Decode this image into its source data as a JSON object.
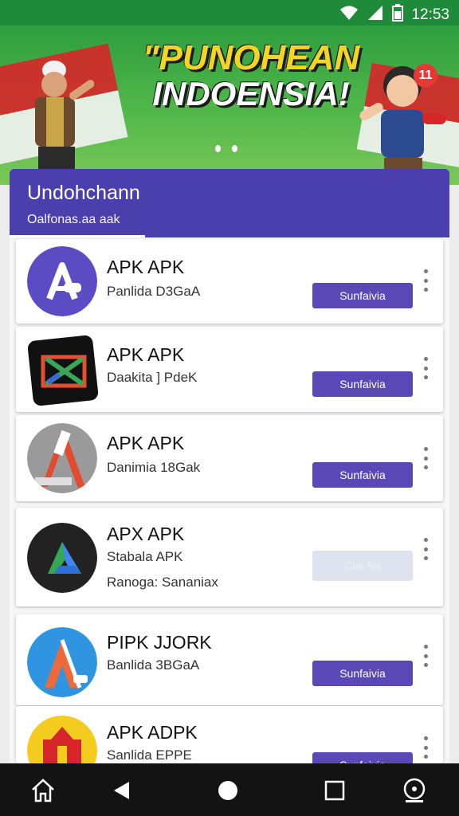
{
  "status_bar": {
    "time": "12:53"
  },
  "banner": {
    "headline_line1": "\"PUNOHEAN",
    "headline_line2": "INDOENSIA!",
    "notification_count": "11"
  },
  "panel": {
    "title": "Undohchann",
    "subtitle": "Oalfonas.aa aak"
  },
  "apps": [
    {
      "title": "APK APK",
      "subtitle": "Panlida D3GaA",
      "button": "Sunfaivia",
      "enabled": true
    },
    {
      "title": "APK APK",
      "subtitle": "Daakita ] PdeK",
      "button": "Sunfaivia",
      "enabled": true
    },
    {
      "title": "APK APK",
      "subtitle": "Danimia 18Gak",
      "button": "Sunfaivia",
      "enabled": true
    },
    {
      "title": "APX APK",
      "subtitle": "Stabala APK",
      "subtitle2": "Ranoga: Sananiax",
      "button": "Clai Sa",
      "enabled": false
    },
    {
      "title": "PIPK JJORK",
      "subtitle": "Banlida 3BGaA",
      "button": "Sunfaivia",
      "enabled": true
    },
    {
      "title": "APK ADPK",
      "subtitle": "Sanlida EPPE",
      "button": "Sunfaivia",
      "enabled": true
    }
  ],
  "colors": {
    "accent": "#5948b5",
    "header": "#4b3fae",
    "banner_green": "#2e9e3f",
    "status_green": "#1f8a3a"
  }
}
